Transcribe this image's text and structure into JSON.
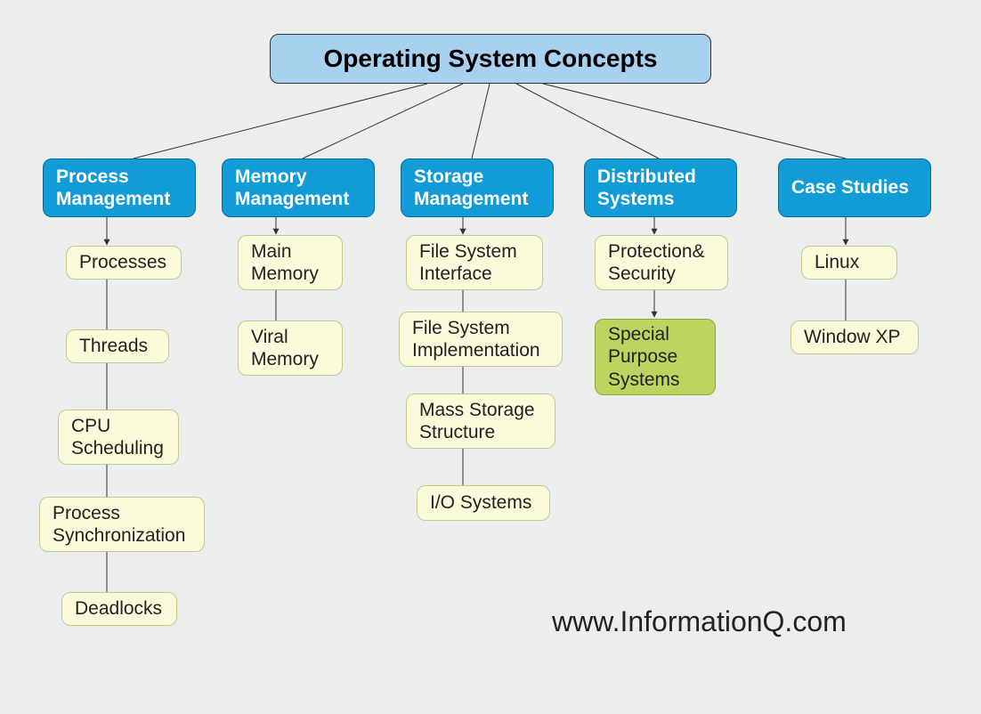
{
  "root": {
    "title": "Operating System Concepts"
  },
  "categories": {
    "process": {
      "label": "Process Management"
    },
    "memory": {
      "label": "Memory Management"
    },
    "storage": {
      "label": "Storage Management"
    },
    "distributed": {
      "label": "Distributed Systems"
    },
    "case": {
      "label": "Case Studies"
    }
  },
  "leaves": {
    "processes": {
      "label": "Processes"
    },
    "threads": {
      "label": "Threads"
    },
    "cpu_sched": {
      "label": "CPU Scheduling"
    },
    "proc_sync": {
      "label": "Process Synchronization"
    },
    "deadlocks": {
      "label": "Deadlocks"
    },
    "main_mem": {
      "label": "Main Memory"
    },
    "viral_mem": {
      "label": "Viral Memory"
    },
    "fs_interface": {
      "label": "File System Interface"
    },
    "fs_impl": {
      "label": "File System Implementation"
    },
    "mass_storage": {
      "label": "Mass Storage Structure"
    },
    "io_systems": {
      "label": "I/O Systems"
    },
    "prot_sec": {
      "label": "Protection& Security"
    },
    "special_sys": {
      "label": "Special Purpose Systems"
    },
    "linux": {
      "label": "Linux"
    },
    "window_xp": {
      "label": "Window XP"
    }
  },
  "credit": "www.InformationQ.com",
  "colors": {
    "background": "#eceeed",
    "root_fill": "#a8d1f0",
    "category_fill": "#119cd8",
    "leaf_fill": "#fbfbdc",
    "special_fill": "#bcd35f"
  }
}
